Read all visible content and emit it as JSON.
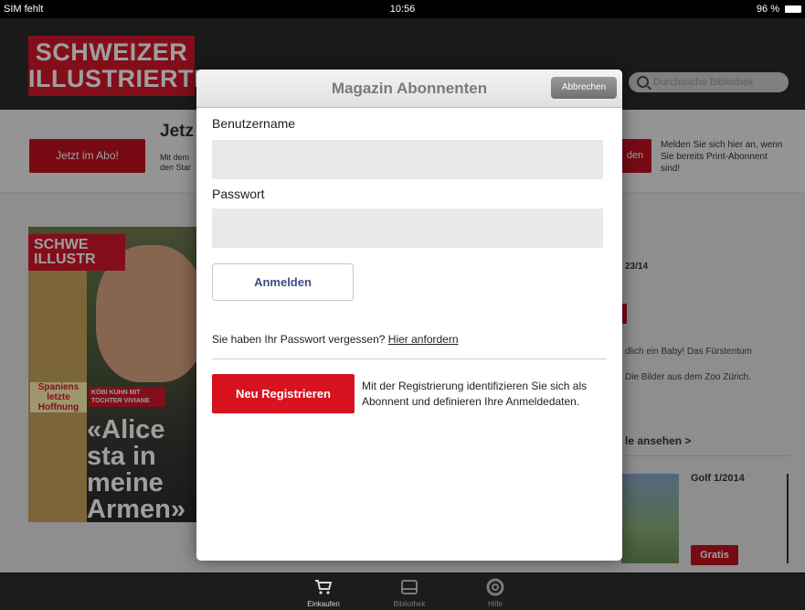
{
  "status_bar": {
    "carrier": "SIM fehlt",
    "time": "10:56",
    "battery": "96 %"
  },
  "header": {
    "logo_line1": "SCHWEIZER",
    "logo_line2": "ILLUSTRIERTE",
    "search_placeholder": "Durchsuche Bibliothek"
  },
  "promo": {
    "abo_button": "Jetzt im Abo!",
    "title": "Jetz",
    "text": "Mit dem den Star",
    "login_fragment": "den",
    "melden_text": "Melden Sie sich hier an, wenn Sie bereits Print-Abonnent sind!"
  },
  "cover": {
    "logo_line1": "SCHWE",
    "logo_line2": "ILLUSTR",
    "kicker": "KÖBI KUHN MIT TOCHTER VIVIANE",
    "headline": "«Alice sta in meine Armen»",
    "side_story": "Spaniens letzte Hoffnung"
  },
  "issue": {
    "date_fragment": "23/14",
    "fragment1": "dlich ein Baby! Das Fürstentum",
    "fragment2": "Die Bilder aus dem Zoo Zürich.",
    "see_all": "le ansehen >"
  },
  "golf": {
    "title": "Golf 1/2014",
    "badge": "Gratis"
  },
  "modal": {
    "title": "Magazin Abonnenten",
    "cancel": "Abbrechen",
    "username_label": "Benutzername",
    "username_value": "",
    "password_label": "Passwort",
    "password_value": "",
    "login_button": "Anmelden",
    "forgot_text": "Sie haben Ihr Passwort vergessen?",
    "forgot_link": "Hier anfordern",
    "register_button": "Neu Registrieren",
    "register_text": "Mit der Registrierung identifizieren Sie sich als Abonnent und definieren Ihre Anmeldedaten."
  },
  "tabs": [
    {
      "label": "Einkaufen",
      "icon": "cart-icon"
    },
    {
      "label": "Bibliothek",
      "icon": "library-icon"
    },
    {
      "label": "Hilfe",
      "icon": "help-icon"
    }
  ],
  "colors": {
    "brand_red": "#d4172a",
    "button_red": "#d9121f",
    "login_text": "#3c4f7e"
  }
}
